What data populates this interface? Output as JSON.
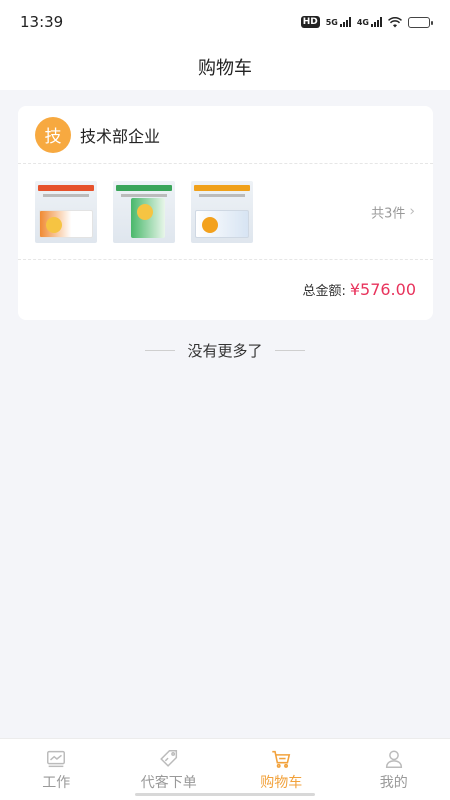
{
  "status_bar": {
    "time": "13:39",
    "hd": "HD",
    "network": "5G",
    "network2": "4G",
    "battery_level": 0.4
  },
  "nav": {
    "title": "购物车"
  },
  "cart": {
    "shop": {
      "avatar_text": "技",
      "name": "技术部企业"
    },
    "items": [
      {
        "icon": "product-thumbnail-1"
      },
      {
        "icon": "product-thumbnail-2"
      },
      {
        "icon": "product-thumbnail-3"
      }
    ],
    "item_count": "共3件",
    "total_label": "总金额:",
    "total_value": "¥576.00"
  },
  "list_end_text": "没有更多了",
  "tabs": [
    {
      "label": "工作",
      "icon": "chart-icon",
      "active": false
    },
    {
      "label": "代客下单",
      "icon": "tag-icon",
      "active": false
    },
    {
      "label": "购物车",
      "icon": "cart-icon",
      "active": true
    },
    {
      "label": "我的",
      "icon": "user-icon",
      "active": false
    }
  ],
  "colors": {
    "accent": "#f2a23c",
    "price": "#e8335c",
    "avatar": "#f7a940",
    "background": "#f4f5f9"
  }
}
